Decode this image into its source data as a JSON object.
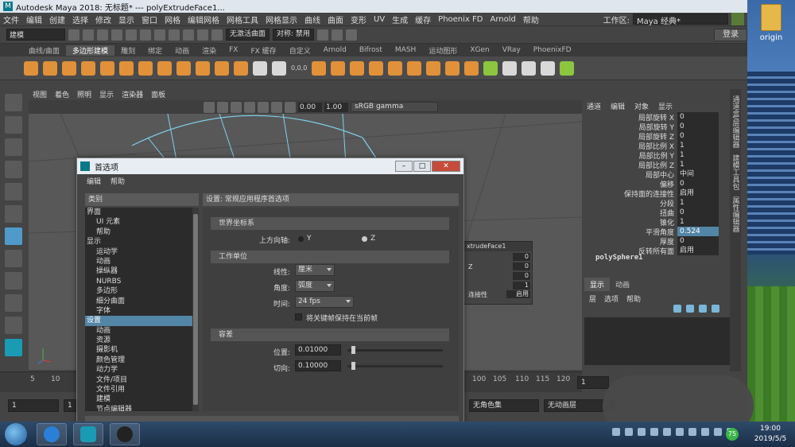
{
  "window": {
    "title": "Autodesk Maya 2018: 无标题*    ---    polyExtrudeFace1..."
  },
  "menubar": {
    "items": [
      "文件",
      "编辑",
      "创建",
      "选择",
      "修改",
      "显示",
      "窗口",
      "网格",
      "编辑网格",
      "网格工具",
      "网格显示",
      "曲线",
      "曲面",
      "变形",
      "UV",
      "生成",
      "缓存",
      "Phoenix FD",
      "Arnold",
      "帮助"
    ],
    "workspace_label": "工作区:",
    "workspace_value": "Maya 经典*"
  },
  "statusline": {
    "mode": "建模",
    "no_live_surface": "无激活曲面",
    "symmetry": "对称: 禁用",
    "login": "登录"
  },
  "shelf": {
    "tabs": [
      "曲线/曲面",
      "多边形建模",
      "雕刻",
      "绑定",
      "动画",
      "渲染",
      "FX",
      "FX 缓存",
      "自定义",
      "Arnold",
      "Bifrost",
      "MASH",
      "运动图形",
      "XGen",
      "VRay",
      "PhoenixFD"
    ],
    "active_tab": 1,
    "coord_label": "0,0,0"
  },
  "viewport": {
    "menu": [
      "视图",
      "着色",
      "照明",
      "显示",
      "渲染器",
      "面板"
    ],
    "exposure": "0.00",
    "gamma_value": "1.00",
    "color_space": "sRGB gamma"
  },
  "channel_box": {
    "menu": [
      "通道",
      "编辑",
      "对象",
      "显示"
    ],
    "rows": [
      {
        "label": "局部旋转 X",
        "value": "0"
      },
      {
        "label": "局部旋转 Y",
        "value": "0"
      },
      {
        "label": "局部旋转 Z",
        "value": "0"
      },
      {
        "label": "局部比例 X",
        "value": "1"
      },
      {
        "label": "局部比例 Y",
        "value": "1"
      },
      {
        "label": "局部比例 Z",
        "value": "1"
      },
      {
        "label": "局部中心",
        "value": "中间"
      },
      {
        "label": "偏移",
        "value": "0"
      },
      {
        "label": "保持面的连接性",
        "value": "启用"
      },
      {
        "label": "分段",
        "value": "1"
      },
      {
        "label": "扭曲",
        "value": "0"
      },
      {
        "label": "锥化",
        "value": "1"
      },
      {
        "label": "平滑角度",
        "value": "0.524"
      },
      {
        "label": "厚度",
        "value": "0"
      },
      {
        "label": "反转所有面",
        "value": "启用"
      }
    ],
    "highlighted_row": 12,
    "node_name": "polySphere1",
    "side_tabs": [
      "通道盒/层编辑器",
      "建模工具包",
      "属性编辑器"
    ]
  },
  "layer_editor": {
    "tabs": [
      "显示",
      "动画"
    ],
    "menu": [
      "层",
      "选项",
      "帮助"
    ]
  },
  "float_panel": {
    "title": "xtrudeFace1",
    "values": [
      "0",
      "0",
      "0",
      "1"
    ],
    "z_label": "Z",
    "conn_label": "连接性",
    "conn_value": "启用"
  },
  "timeline": {
    "ticks": [
      "5",
      "10",
      "100",
      "105",
      "110",
      "115",
      "120"
    ],
    "current_frame": "1"
  },
  "range": {
    "start": "1",
    "current": "1",
    "char_set": "无角色集",
    "anim_layer": "无动画层"
  },
  "dialog": {
    "title": "首选项",
    "menu": [
      "编辑",
      "帮助"
    ],
    "categories_header": "类别",
    "categories": [
      {
        "label": "界面",
        "sub": false
      },
      {
        "label": "UI 元素",
        "sub": true
      },
      {
        "label": "帮助",
        "sub": true
      },
      {
        "label": "显示",
        "sub": false
      },
      {
        "label": "运动学",
        "sub": true
      },
      {
        "label": "动画",
        "sub": true
      },
      {
        "label": "操纵器",
        "sub": true
      },
      {
        "label": "NURBS",
        "sub": true
      },
      {
        "label": "多边形",
        "sub": true
      },
      {
        "label": "细分曲面",
        "sub": true
      },
      {
        "label": "字体",
        "sub": true
      },
      {
        "label": "设置",
        "sub": false
      },
      {
        "label": "动画",
        "sub": true
      },
      {
        "label": "资源",
        "sub": true
      },
      {
        "label": "摄影机",
        "sub": true
      },
      {
        "label": "颜色管理",
        "sub": true
      },
      {
        "label": "动力学",
        "sub": true
      },
      {
        "label": "文件/项目",
        "sub": true
      },
      {
        "label": "文件引用",
        "sub": true
      },
      {
        "label": "建模",
        "sub": true
      },
      {
        "label": "节点编辑器",
        "sub": true
      }
    ],
    "selected_category": 11,
    "settings_header": "设置: 常规应用程序首选项",
    "world_section": "世界坐标系",
    "up_axis_label": "上方向轴:",
    "up_axis_y": "Y",
    "up_axis_z": "Z",
    "units_section": "工作单位",
    "linear_label": "线性:",
    "linear_value": "厘米",
    "angular_label": "角度:",
    "angular_value": "弧度",
    "time_label": "时间:",
    "time_value": "24 fps",
    "keep_keys_label": "将关键帧保持在当前帧",
    "tolerance_section": "容差",
    "position_label": "位置:",
    "position_value": "0.01000",
    "tangent_label": "切向:",
    "tangent_value": "0.10000"
  },
  "desktop": {
    "icon_label": "origin"
  },
  "taskbar": {
    "clock_time": "19:00",
    "clock_date": "2019/5/5",
    "badge": "75"
  }
}
